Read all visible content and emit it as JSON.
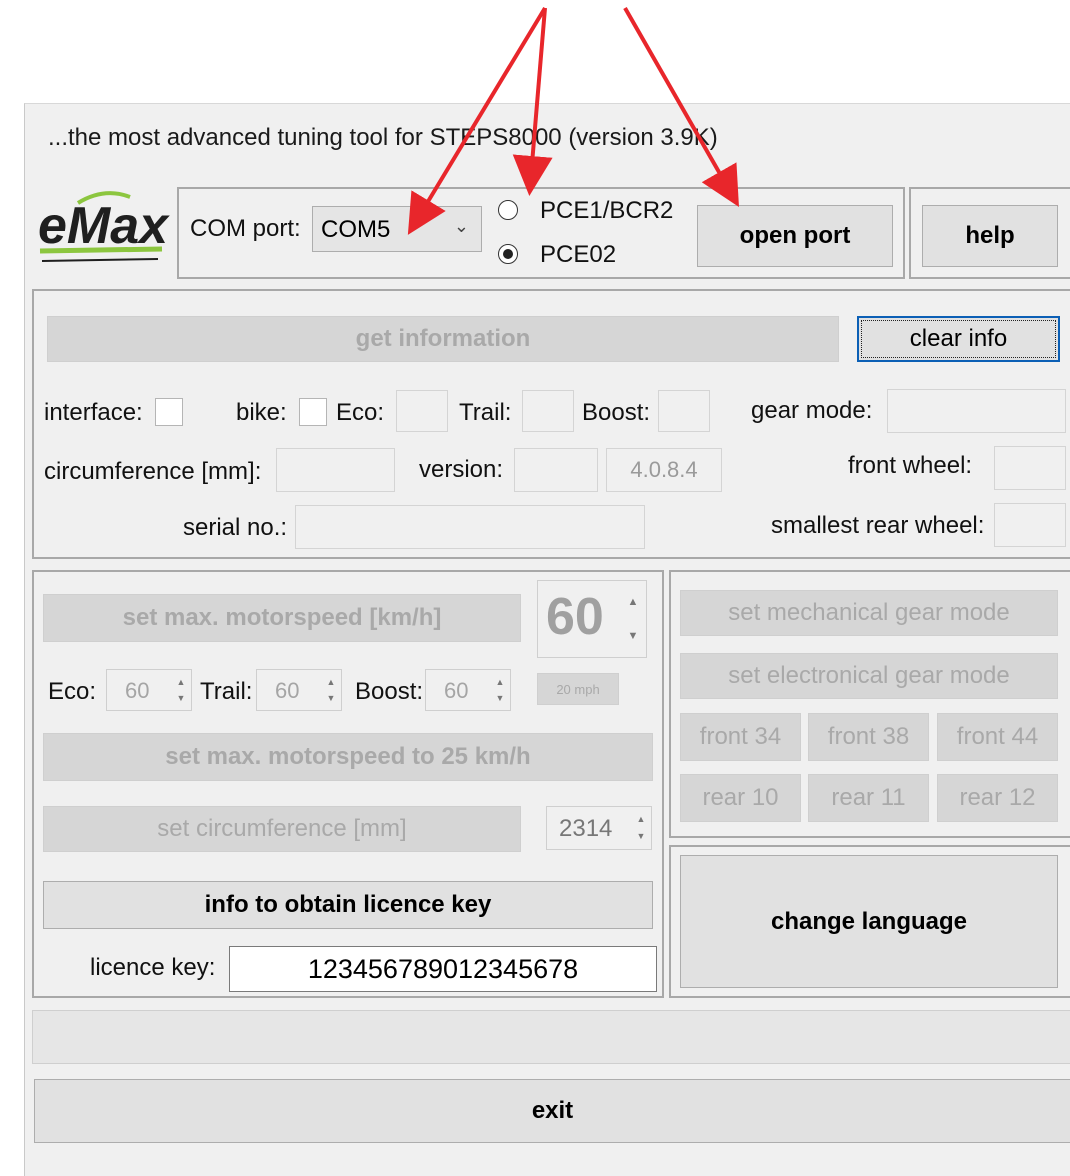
{
  "title": "...the most advanced tuning tool for STEPS8000 (version 3.9K)",
  "logo_text": "eMax",
  "connection": {
    "com_label": "COM port:",
    "com_value": "COM5",
    "radio_1": "PCE1/BCR2",
    "radio_2": "PCE02",
    "radio_selected": "PCE02",
    "open_port": "open port",
    "help": "help"
  },
  "info": {
    "get_information": "get information",
    "clear_info": "clear info",
    "interface_label": "interface:",
    "bike_label": "bike:",
    "eco_label": "Eco:",
    "trail_label": "Trail:",
    "boost_label": "Boost:",
    "gear_mode_label": "gear mode:",
    "circumference_label": "circumference [mm]:",
    "version_label": "version:",
    "version_value": "4.0.8.4",
    "front_wheel_label": "front wheel:",
    "serial_label": "serial no.:",
    "smallest_rear_label": "smallest rear wheel:"
  },
  "speed": {
    "set_max_motorspeed": "set max. motorspeed [km/h]",
    "max_speed_value": "60",
    "eco_label": "Eco:",
    "eco_value": "60",
    "trail_label": "Trail:",
    "trail_value": "60",
    "boost_label": "Boost:",
    "boost_value": "60",
    "mph_button": "20 mph",
    "set_25": "set max. motorspeed to 25 km/h",
    "set_circumference": "set circumference [mm]",
    "circumference_value": "2314",
    "licence_info": "info to obtain licence key",
    "licence_label": "licence key:",
    "licence_value": "123456789012345678"
  },
  "gear": {
    "mechanical": "set mechanical gear mode",
    "electronical": "set electronical gear mode",
    "front_34": "front 34",
    "front_38": "front 38",
    "front_44": "front 44",
    "rear_10": "rear 10",
    "rear_11": "rear 11",
    "rear_12": "rear 12"
  },
  "change_language": "change language",
  "status_bar": "",
  "exit": "exit",
  "colors": {
    "arrow": "#e8262b",
    "logo_green": "#8cc63f",
    "window_bg": "#f0f0f0"
  }
}
